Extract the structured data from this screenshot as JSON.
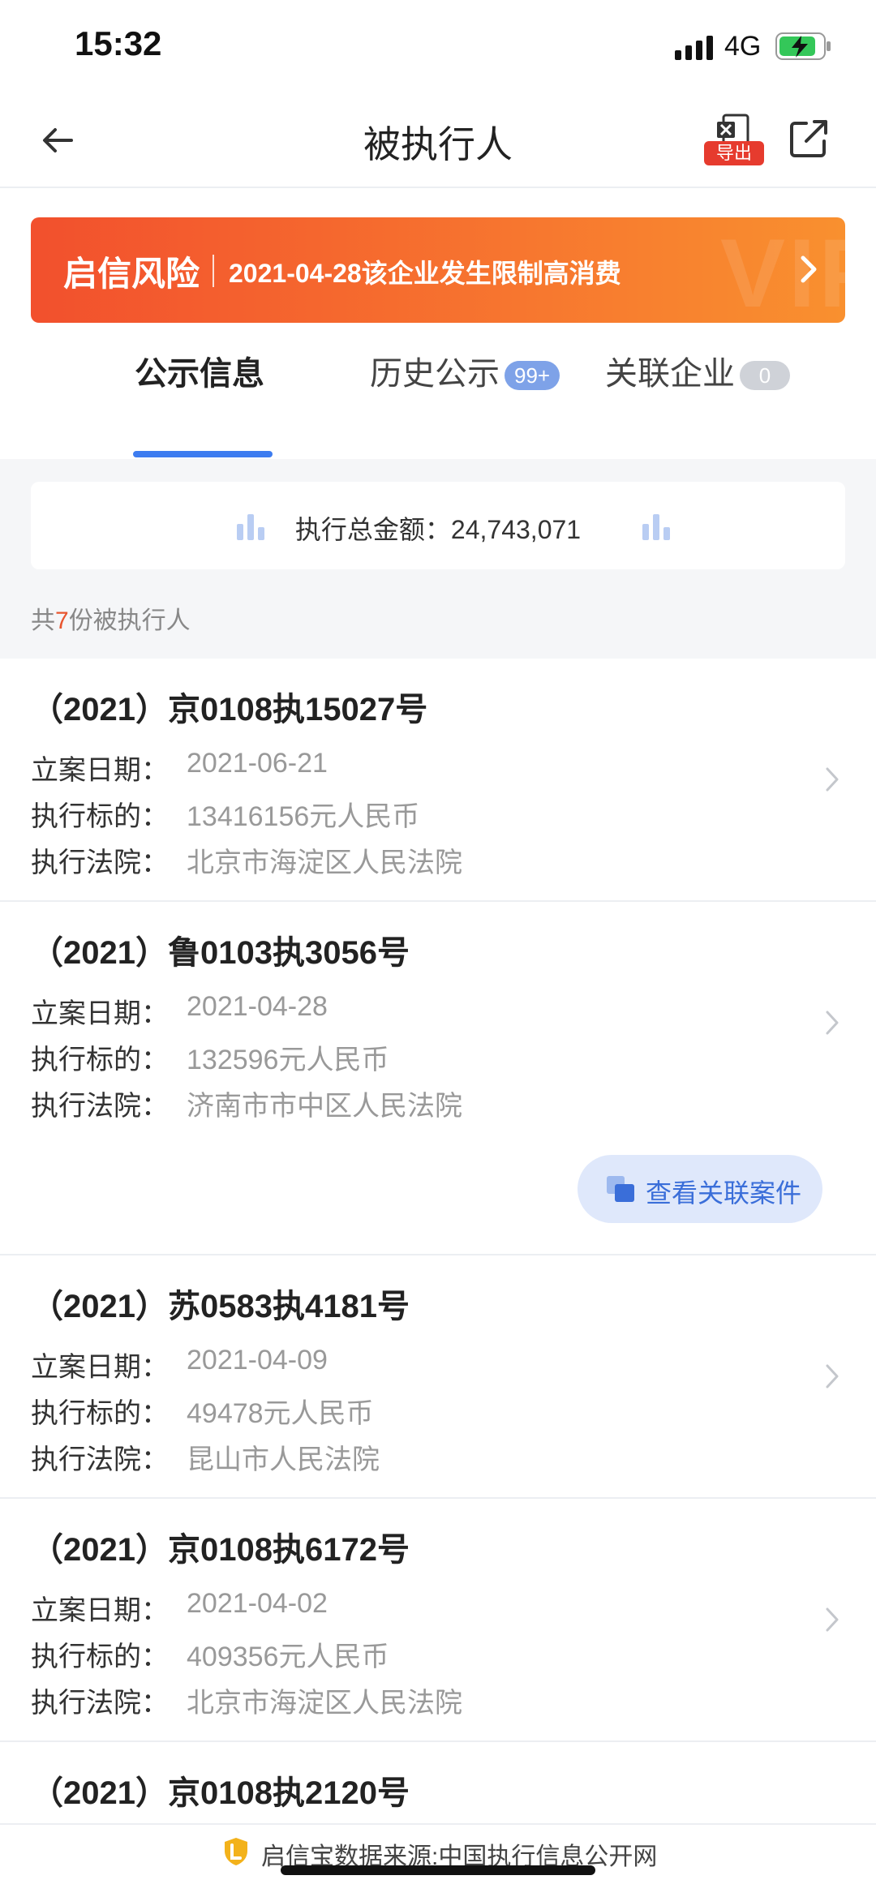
{
  "status_bar": {
    "time": "15:32",
    "network": "4G"
  },
  "nav": {
    "title": "被执行人",
    "export_label": "导出"
  },
  "banner": {
    "brand": "启信风险",
    "message": "2021-04-28该企业发生限制高消费",
    "watermark": "VIP",
    "color_start": "#f2502d",
    "color_end": "#f9902f"
  },
  "tabs": [
    {
      "label": "公示信息",
      "count": ""
    },
    {
      "label": "历史公示",
      "count": "99+"
    },
    {
      "label": "关联企业",
      "count": "0"
    }
  ],
  "summary": {
    "label": "执行总金额：",
    "amount": "24,743,071"
  },
  "count_line": {
    "prefix": "共",
    "count": "7",
    "suffix": "份被执行人"
  },
  "field_labels": {
    "filing_date": "立案日期：",
    "target": "执行标的：",
    "court": "执行法院："
  },
  "cases": [
    {
      "case_no": "（2021）京0108执15027号",
      "filing_date": "2021-06-21",
      "target": "13416156元人民币",
      "court": "北京市海淀区人民法院"
    },
    {
      "case_no": "（2021）鲁0103执3056号",
      "filing_date": "2021-04-28",
      "target": "132596元人民币",
      "court": "济南市市中区人民法院",
      "related_label": "查看关联案件"
    },
    {
      "case_no": "（2021）苏0583执4181号",
      "filing_date": "2021-04-09",
      "target": "49478元人民币",
      "court": "昆山市人民法院"
    },
    {
      "case_no": "（2021）京0108执6172号",
      "filing_date": "2021-04-02",
      "target": "409356元人民币",
      "court": "北京市海淀区人民法院"
    },
    {
      "case_no": "（2021）京0108执2120号"
    }
  ],
  "footer": {
    "source": "启信宝数据来源:中国执行信息公开网"
  },
  "colors": {
    "accent": "#3d7cf0",
    "highlight": "#e8552f",
    "export_badge": "#e63b2e"
  }
}
